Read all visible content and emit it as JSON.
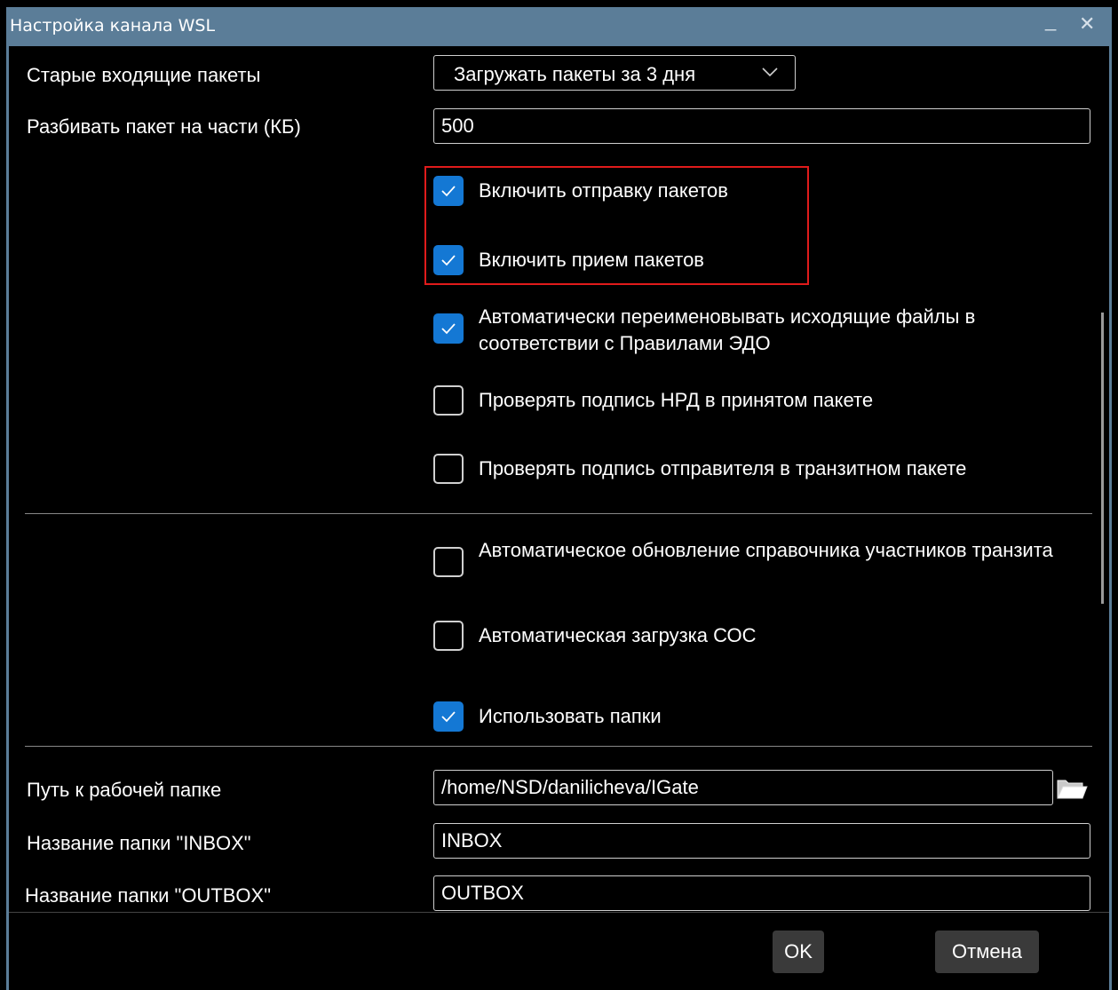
{
  "window": {
    "title": "Настройка канала WSL",
    "minimize_glyph": "_",
    "close_glyph": "✕"
  },
  "old_packets": {
    "label": "Старые входящие пакеты",
    "selected": "Загружать пакеты за 3 дня"
  },
  "split": {
    "label": "Разбивать пакет на части (КБ)",
    "value": "500"
  },
  "checkboxes": [
    {
      "label": "Включить отправку пакетов",
      "checked": true
    },
    {
      "label": "Включить прием пакетов",
      "checked": true
    },
    {
      "label": "Автоматически переименовывать исходящие файлы в соответствии с Правилами ЭДО",
      "checked": true
    },
    {
      "label": "Проверять подпись НРД в принятом пакете",
      "checked": false
    },
    {
      "label": "Проверять подпись отправителя в транзитном пакете",
      "checked": false
    },
    {
      "label": "Автоматическое обновление справочника участников транзита",
      "checked": false
    },
    {
      "label": "Автоматическая загрузка СОС",
      "checked": false
    },
    {
      "label": "Использовать папки",
      "checked": true
    }
  ],
  "work_folder": {
    "label": "Путь к рабочей папке",
    "value": "/home/NSD/danilicheva/IGate"
  },
  "inbox": {
    "label": "Название папки \"INBOX\"",
    "value": "INBOX"
  },
  "outbox": {
    "label": "Название папки \"OUTBOX\"",
    "value": "OUTBOX"
  },
  "buttons": {
    "ok": "OK",
    "cancel": "Отмена"
  },
  "colors": {
    "titlebar": "#5b7d98",
    "checkbox_on": "#1478d4",
    "highlight": "#e01b1b"
  },
  "icons": {
    "folder": "folder-open-icon",
    "chevron": "chevron-down-icon",
    "check": "check-icon"
  }
}
